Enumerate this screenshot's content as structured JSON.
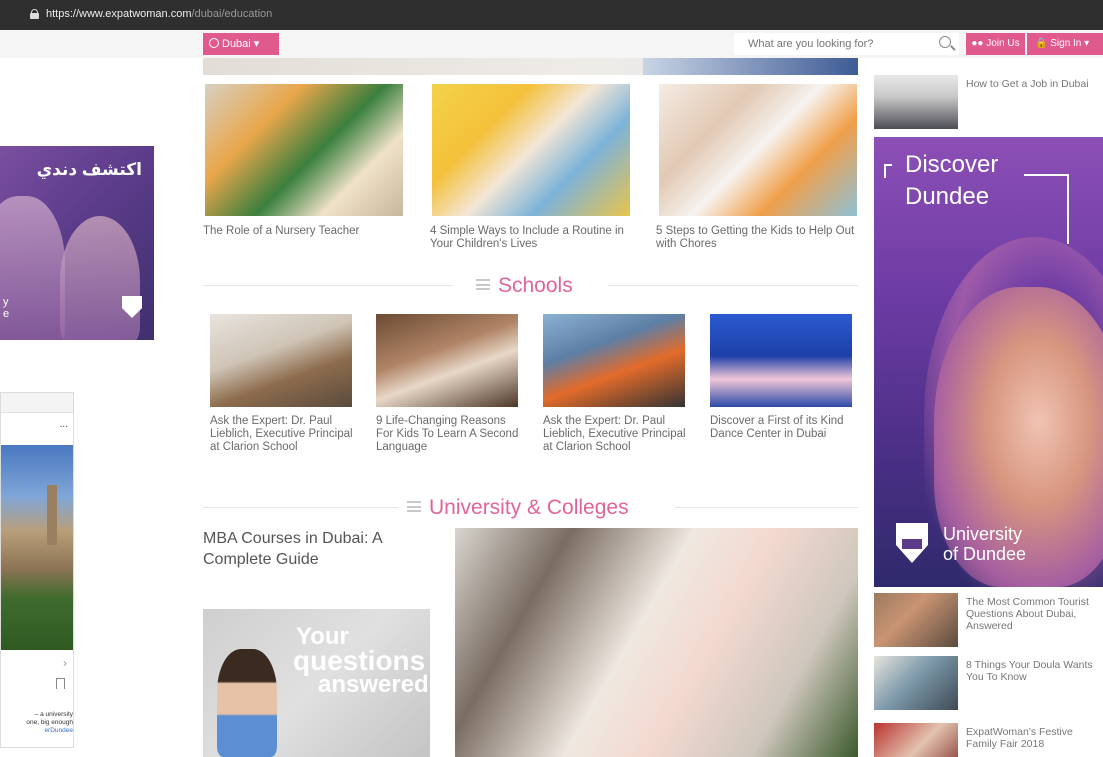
{
  "browser": {
    "url_host": "https://www.expatwoman.com",
    "url_path": "/dubai/education"
  },
  "header": {
    "city": "Dubai",
    "search_placeholder": "What are you looking for?",
    "join": "Join Us",
    "signin": "Sign In"
  },
  "left_ad": {
    "arabic_text": "اكتشف دندي",
    "partial_text": "y\ne"
  },
  "fb_card": {
    "dots": "...",
    "caption_text": "– a university\none, big enough",
    "caption_link": "erDundee"
  },
  "top_articles": [
    {
      "title": "The Role of a Nursery Teacher"
    },
    {
      "title": "4 Simple Ways to Include a Routine in Your Children's Lives"
    },
    {
      "title": "5 Steps to Getting the Kids to Help Out with Chores"
    }
  ],
  "schools": {
    "heading": "Schools",
    "items": [
      {
        "title": "Ask the Expert: Dr. Paul Lieblich, Executive Principal at Clarion School"
      },
      {
        "title": "9 Life-Changing Reasons For Kids To Learn A Second Language"
      },
      {
        "title": "Ask the Expert: Dr. Paul Lieblich, Executive Principal at Clarion School"
      },
      {
        "title": "Discover a First of its Kind Dance Center in Dubai"
      }
    ]
  },
  "university": {
    "heading": "University & Colleges",
    "feature_title": "MBA Courses in Dubai: A Complete Guide",
    "promo_line1": "Your",
    "promo_line2": "questions",
    "promo_line3": "answered"
  },
  "sidebar": {
    "top_item": "How to Get a Job in Dubai",
    "ad": {
      "line1": "Discover",
      "line2": "Dundee",
      "uni1": "University",
      "uni2": "of Dundee"
    },
    "items": [
      {
        "title": "The Most Common Tourist Questions About Dubai, Answered"
      },
      {
        "title": "8 Things Your Doula Wants You To Know"
      },
      {
        "title": "ExpatWoman's Festive Family Fair 2018"
      }
    ]
  }
}
